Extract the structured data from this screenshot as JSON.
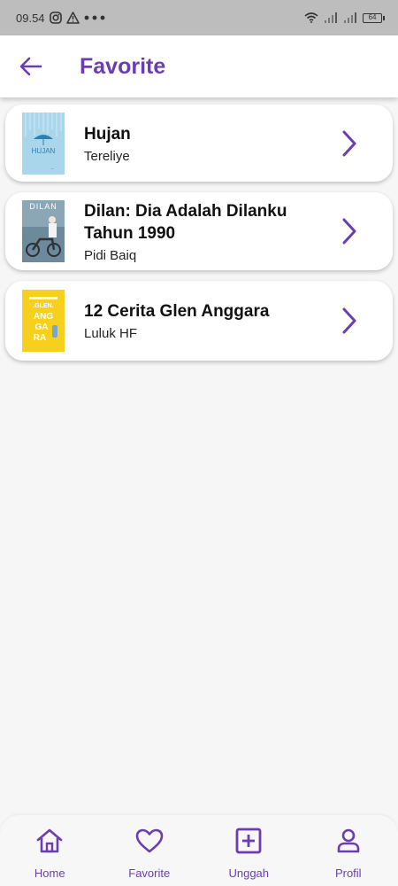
{
  "status_bar": {
    "time": "09.54",
    "battery": "64",
    "icons": [
      "instagram-icon",
      "warning-icon",
      "more-dots-icon",
      "wifi-icon",
      "signal-icon",
      "signal-icon",
      "battery-icon"
    ]
  },
  "header": {
    "title": "Favorite",
    "back_icon": "arrow-left-icon"
  },
  "books": [
    {
      "title": "Hujan",
      "author": "Tereliye",
      "cover_text": "HUJAN",
      "cover_color": "#9fd0e6"
    },
    {
      "title": "Dilan: Dia Adalah Dilanku Tahun 1990",
      "author": "Pidi Baiq",
      "cover_text": "DILAN",
      "cover_color": "#6b8799"
    },
    {
      "title": "12 Cerita Glen Anggara",
      "author": "Luluk HF",
      "cover_text": "ANG GA RA",
      "cover_color": "#f7cf1d"
    }
  ],
  "bottom_nav": {
    "items": [
      {
        "label": "Home",
        "icon": "home-icon"
      },
      {
        "label": "Favorite",
        "icon": "heart-icon"
      },
      {
        "label": "Unggah",
        "icon": "plus-square-icon"
      },
      {
        "label": "Profil",
        "icon": "user-icon"
      }
    ]
  },
  "colors": {
    "accent": "#6a3db3",
    "status_bar_bg": "#bdbdbd",
    "page_bg": "#f6f6f6"
  }
}
